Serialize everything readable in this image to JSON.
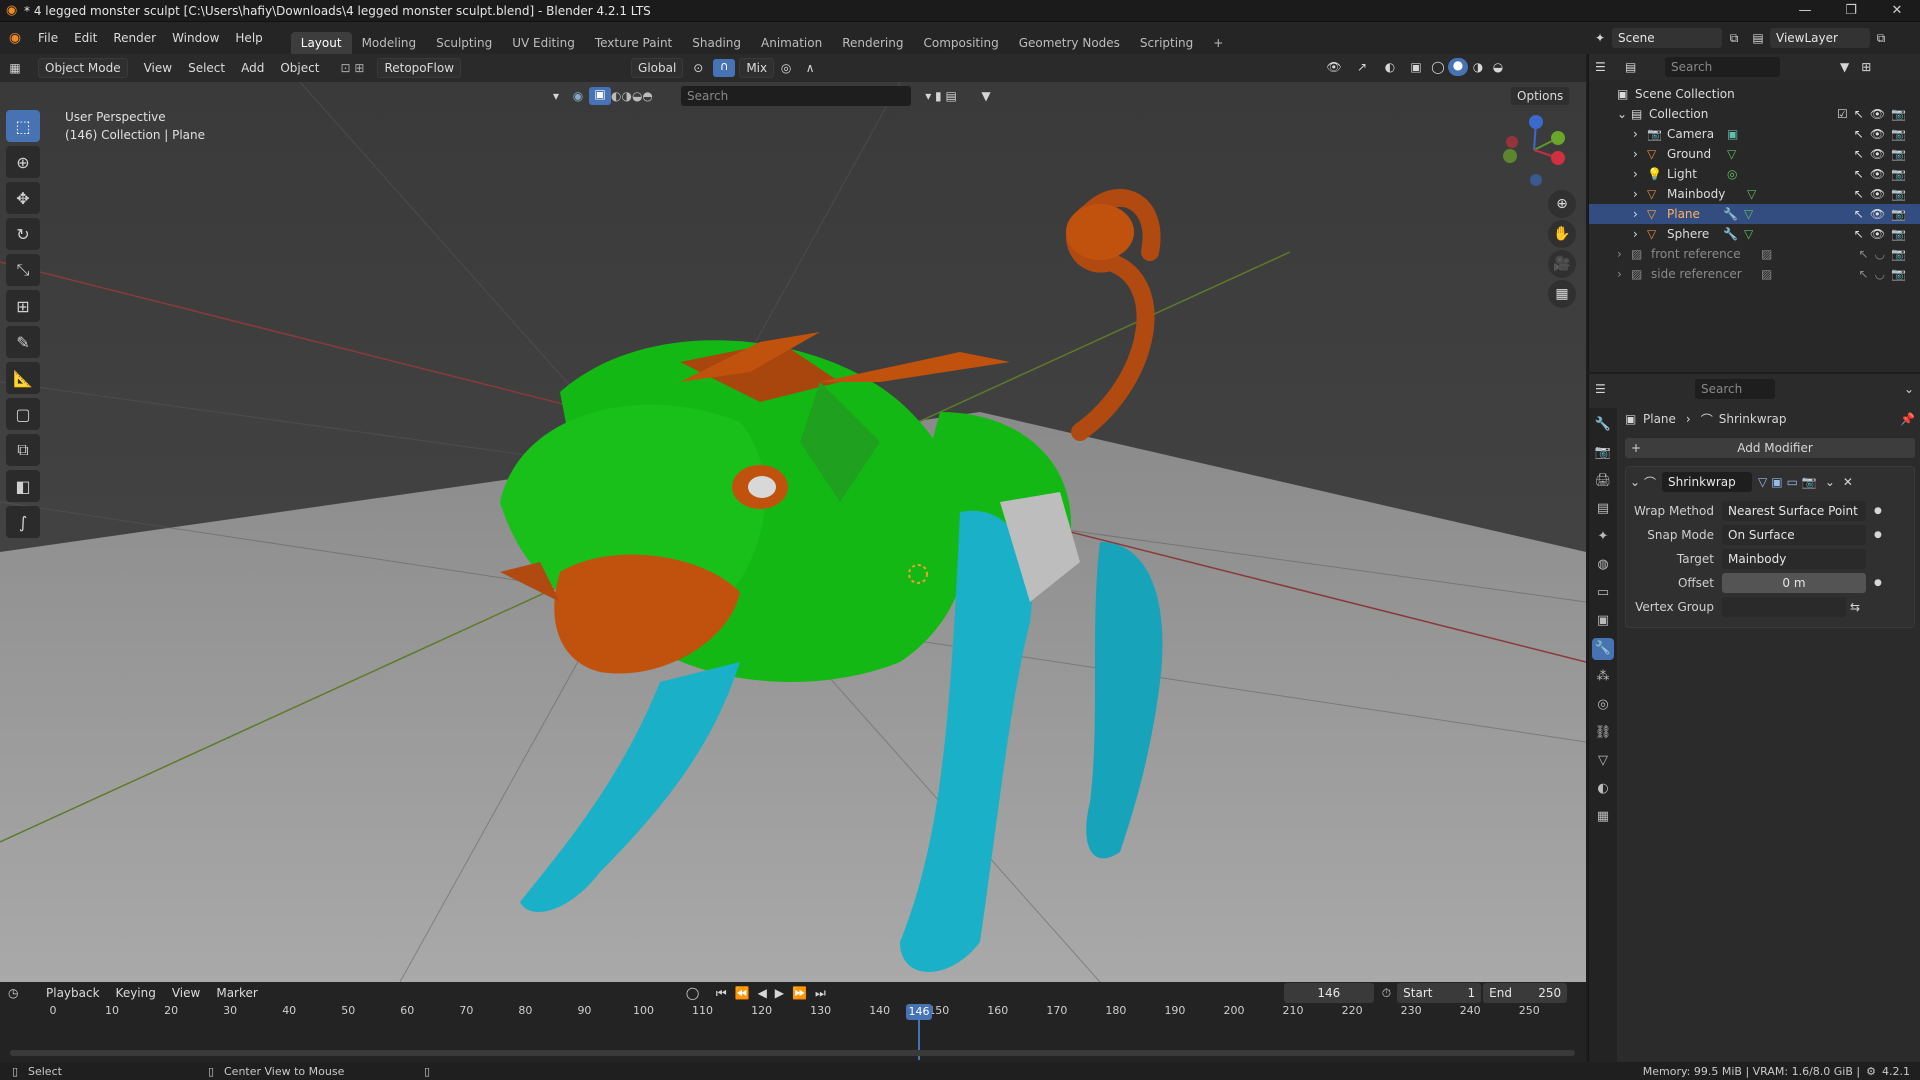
{
  "titlebar": {
    "title": "* 4 legged monster sculpt [C:\\Users\\hafiy\\Downloads\\4 legged monster sculpt.blend] - Blender 4.2.1 LTS"
  },
  "menu": {
    "items": [
      "File",
      "Edit",
      "Render",
      "Window",
      "Help"
    ]
  },
  "workspaces": [
    "Layout",
    "Modeling",
    "Sculpting",
    "UV Editing",
    "Texture Paint",
    "Shading",
    "Animation",
    "Rendering",
    "Compositing",
    "Geometry Nodes",
    "Scripting"
  ],
  "active_workspace": "Layout",
  "scene": {
    "label": "Scene",
    "viewlayer": "ViewLayer"
  },
  "viewport_header": {
    "mode": "Object Mode",
    "menus": [
      "View",
      "Select",
      "Add",
      "Object"
    ],
    "addon": "RetopoFlow",
    "transform": "Global",
    "snap": "Mix",
    "search_placeholder": "Search",
    "options": "Options"
  },
  "viewport": {
    "perspective": "User Perspective",
    "collection_info": "(146) Collection | Plane"
  },
  "outliner": {
    "search_placeholder": "Search",
    "root": "Scene Collection",
    "collection": "Collection",
    "items": [
      {
        "name": "Camera",
        "selected": false,
        "dim": false
      },
      {
        "name": "Ground",
        "selected": false,
        "dim": false
      },
      {
        "name": "Light",
        "selected": false,
        "dim": false
      },
      {
        "name": "Mainbody",
        "selected": false,
        "dim": false
      },
      {
        "name": "Plane",
        "selected": true,
        "dim": false
      },
      {
        "name": "Sphere",
        "selected": false,
        "dim": false
      }
    ],
    "extra": [
      {
        "name": "front reference"
      },
      {
        "name": "side referencer"
      }
    ]
  },
  "properties": {
    "search_placeholder": "Search",
    "breadcrumb_object": "Plane",
    "breadcrumb_modifier": "Shrinkwrap",
    "add_modifier": "Add Modifier",
    "modifier_name": "Shrinkwrap",
    "fields": [
      {
        "label": "Wrap Method",
        "value": "Nearest Surface Point"
      },
      {
        "label": "Snap Mode",
        "value": "On Surface"
      },
      {
        "label": "Target",
        "value": "Mainbody"
      },
      {
        "label": "Offset",
        "value": "0 m"
      },
      {
        "label": "Vertex Group",
        "value": ""
      }
    ]
  },
  "timeline": {
    "menus": [
      "Playback",
      "Keying",
      "View",
      "Marker"
    ],
    "current_frame": "146",
    "start_label": "Start",
    "start": "1",
    "end_label": "End",
    "end": "250",
    "ticks": [
      "0",
      "10",
      "20",
      "30",
      "40",
      "50",
      "60",
      "70",
      "80",
      "90",
      "100",
      "110",
      "120",
      "130",
      "140",
      "150",
      "160",
      "170",
      "180",
      "190",
      "200",
      "210",
      "220",
      "230",
      "240",
      "250"
    ]
  },
  "statusbar": {
    "left": "Select",
    "middle": "Center View to Mouse",
    "right": "Memory: 99.5 MiB | VRAM: 1.6/8.0 GiB |",
    "version": "4.2.1"
  },
  "colors": {
    "accent": "#4772b3",
    "selected_row": "#334d80",
    "model_green": "#14b814",
    "model_orange": "#c1520e",
    "model_cyan": "#1ab0c8"
  }
}
